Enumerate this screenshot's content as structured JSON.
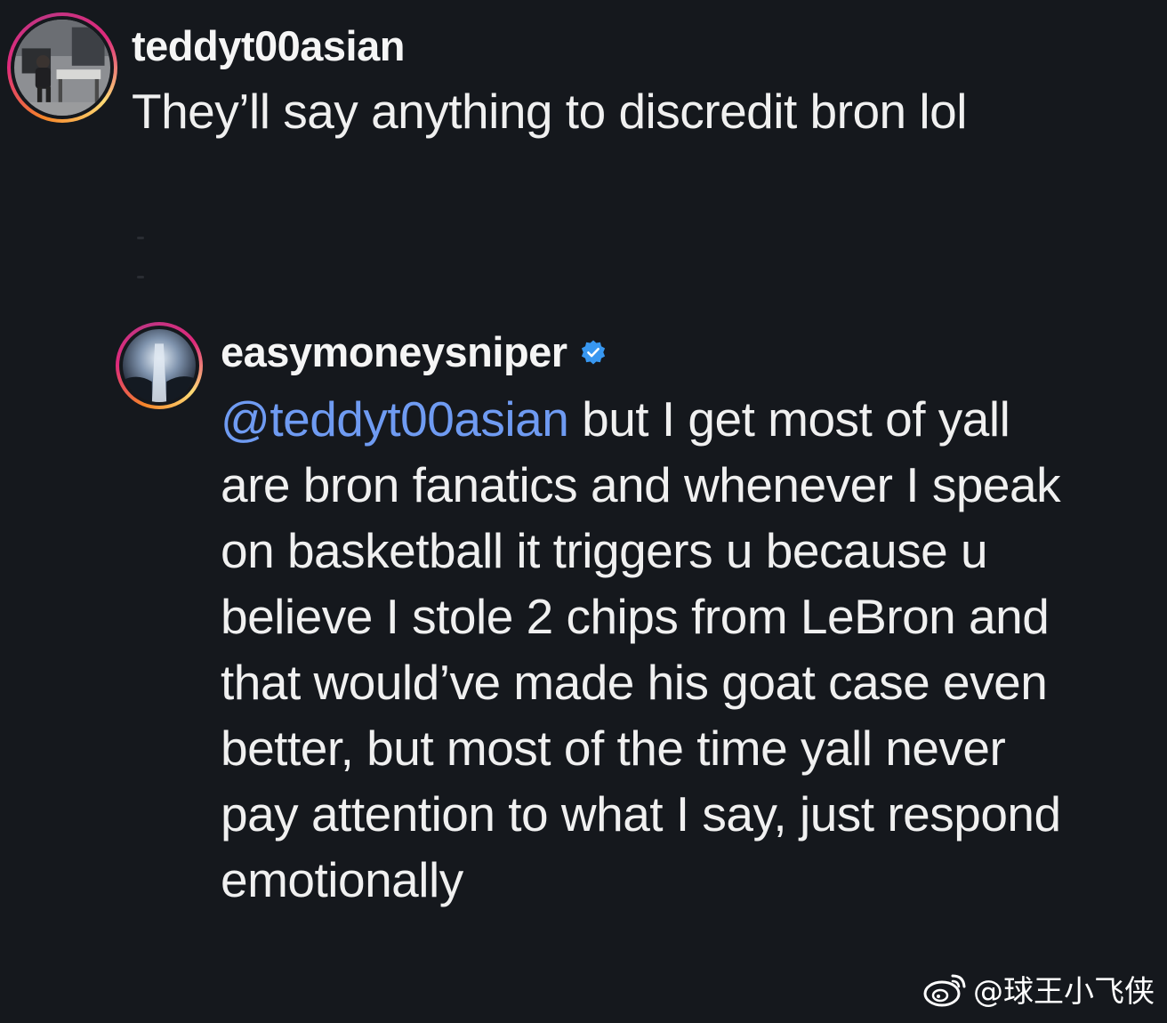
{
  "comments": [
    {
      "username": "teddyt00asian",
      "text": "They’ll say anything to discredit bron lol"
    },
    {
      "username": "easymoneysniper",
      "verified": true,
      "mention": "@teddyt00asian",
      "text": " but I get most of yall are bron fanatics and whenever I speak on basketball it triggers u because u believe I stole 2 chips from LeBron and that would’ve made his goat case even better, but most of the time yall never pay attention to what I say, just respond emotionally"
    }
  ],
  "watermark": {
    "icon": "weibo-logo-icon",
    "handle": "@球王小飞侠"
  },
  "colors": {
    "background": "#15181d",
    "mention": "#6f9bf2",
    "verified": "#3897f0"
  }
}
